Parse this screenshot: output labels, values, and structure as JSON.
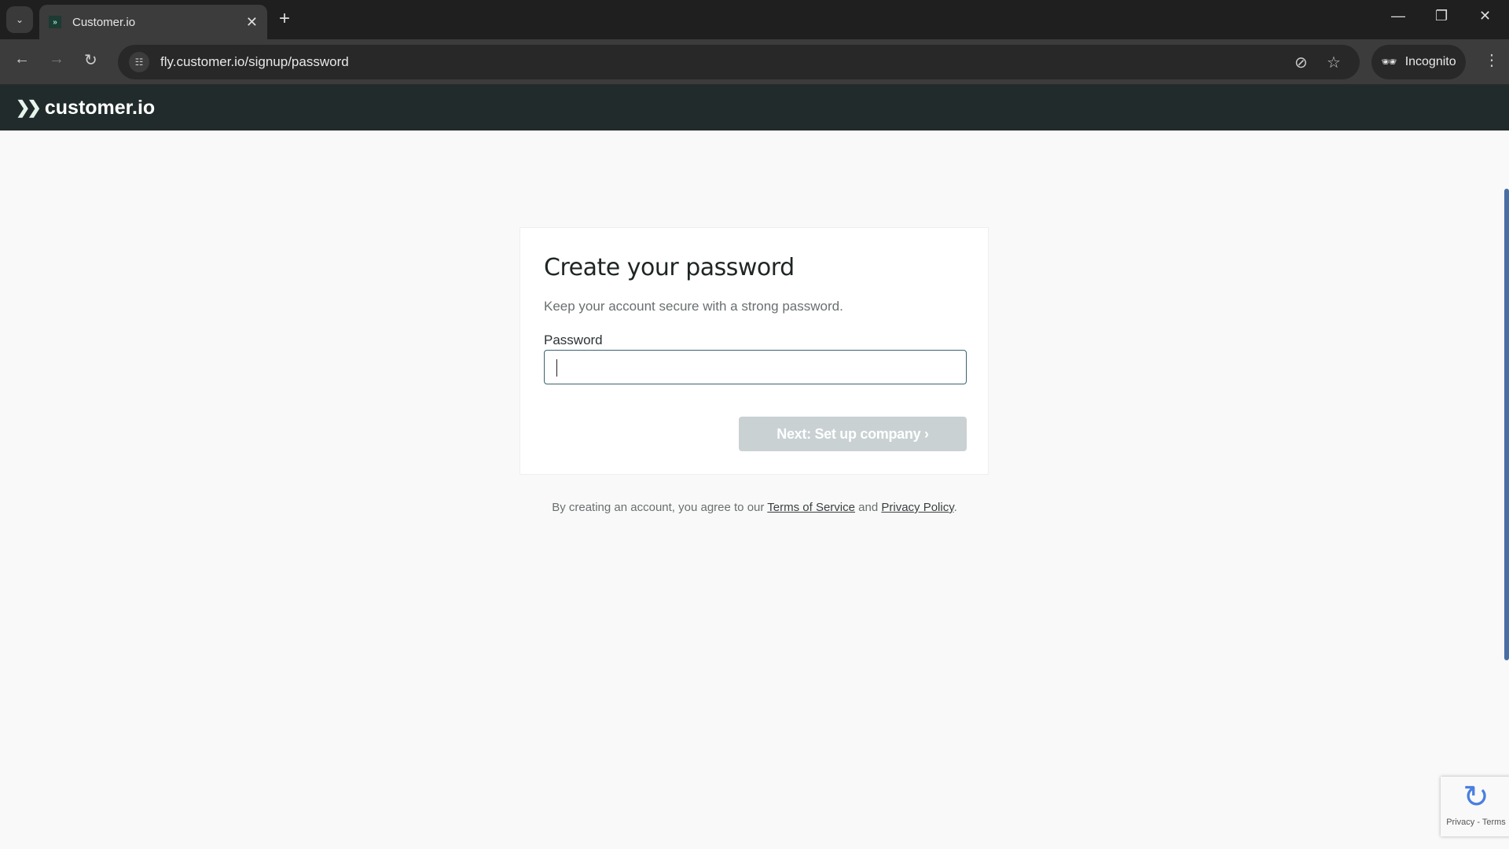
{
  "browser": {
    "tab_title": "Customer.io",
    "url": "fly.customer.io/signup/password",
    "incognito_label": "Incognito"
  },
  "app": {
    "logo_text": "customer.io"
  },
  "form": {
    "title": "Create your password",
    "subtitle": "Keep your account secure with a strong password.",
    "password_label": "Password",
    "password_value": "",
    "next_button": "Next: Set up company",
    "next_enabled": false
  },
  "footer": {
    "prefix": "By creating an account, you agree to our",
    "terms": "Terms of Service",
    "and": "and",
    "privacy": "Privacy Policy",
    "suffix": "."
  },
  "recaptcha": {
    "links": "Privacy - Terms"
  },
  "colors": {
    "header_bg": "#212b2b",
    "button_disabled": "#c9d1d3",
    "input_border": "#3a6270"
  }
}
